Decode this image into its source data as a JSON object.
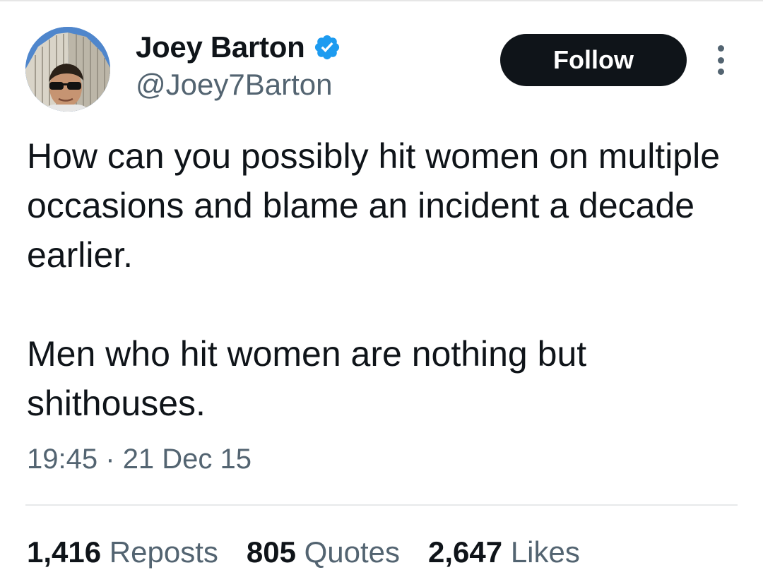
{
  "tweet": {
    "author": {
      "display_name": "Joey Barton",
      "handle": "@Joey7Barton",
      "verified": true,
      "verified_color": "#1d9bf0"
    },
    "follow_label": "Follow",
    "text_paragraphs": [
      "How can you possibly hit women on multiple occasions and blame an incident a decade earlier.",
      "Men who hit women are nothing but shithouses."
    ],
    "time": "19:45",
    "separator": "·",
    "date": "21 Dec 15",
    "stats": {
      "reposts": {
        "count": "1,416",
        "label": "Reposts"
      },
      "quotes": {
        "count": "805",
        "label": "Quotes"
      },
      "likes": {
        "count": "2,647",
        "label": "Likes"
      }
    }
  },
  "colors": {
    "text_primary": "#0f1419",
    "text_secondary": "#536471",
    "follow_button_bg": "#0f1419",
    "divider": "#e7e9ea"
  },
  "icons": {
    "avatar": "profile-photo",
    "verified": "verified-badge-icon",
    "more": "more-options-icon"
  }
}
